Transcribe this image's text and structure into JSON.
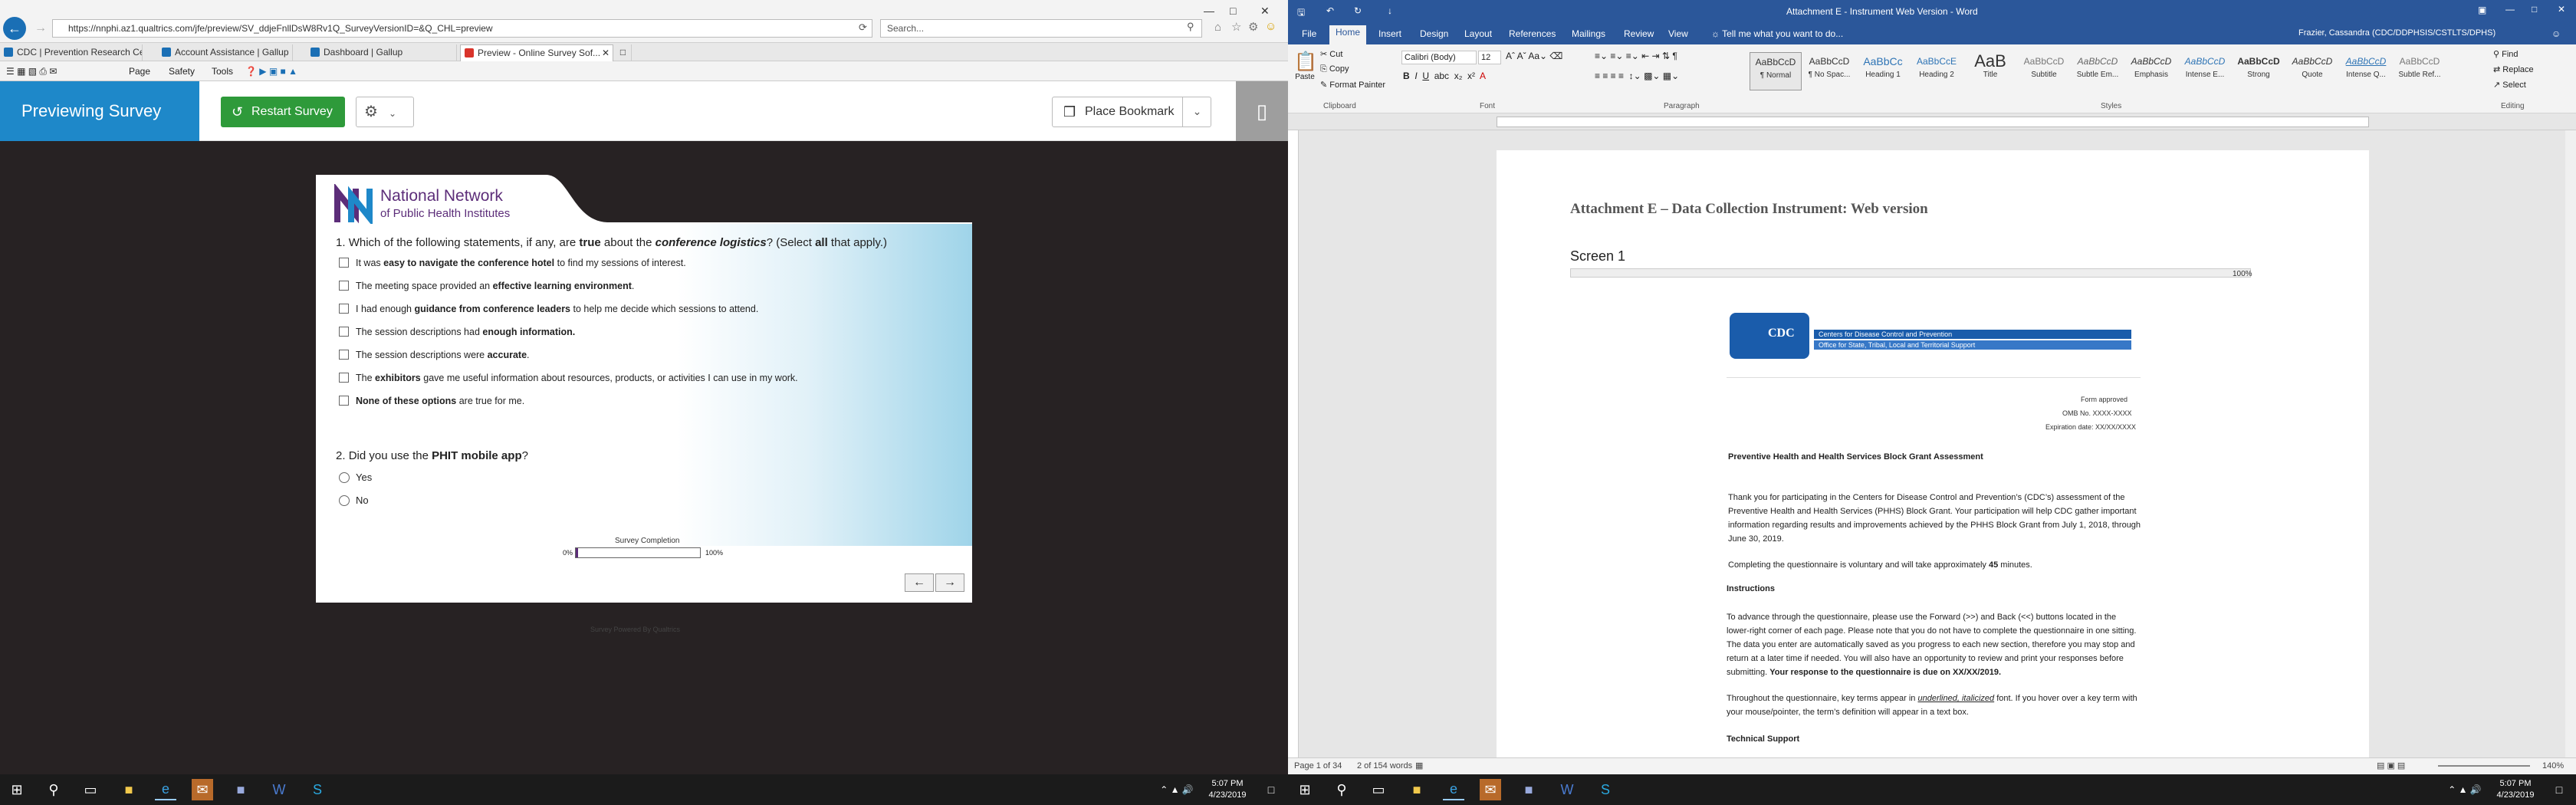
{
  "browser": {
    "url": "https://nnphi.az1.qualtrics.com/jfe/preview/SV_ddjeFnllDsW8Rv1Q_SurveyVersionID=&Q_CHL=preview",
    "search_placeholder": "Search...",
    "tabs": [
      {
        "label": "CDC | Prevention Research Ce...",
        "color": "#1a6fb5"
      },
      {
        "label": "Account Assistance | Gallup",
        "color": "#1a6fb5"
      },
      {
        "label": "Dashboard | Gallup",
        "color": "#1a6fb5"
      },
      {
        "label": "Preview - Online Survey Sof...",
        "color": "#d9342b"
      }
    ],
    "commands": [
      "Page",
      "Safety",
      "Tools"
    ]
  },
  "survey_header": {
    "previewing": "Previewing Survey",
    "restart": "Restart Survey",
    "bookmark": "Place Bookmark"
  },
  "survey": {
    "logo_line1": "National Network",
    "logo_line2": "of Public Health Institutes",
    "q1": {
      "number": "1.",
      "pre": "Which of the following statements, if any, are ",
      "bold1": "true",
      "mid": " about the ",
      "bolditalic": "conference logistics",
      "post1": "? (Select ",
      "bold2": "all",
      "post2": " that apply.)",
      "options": [
        {
          "a": "It was ",
          "b": "easy to navigate the conference hotel",
          "c": " to find my sessions of interest."
        },
        {
          "a": "The meeting space provided an ",
          "b": "effective learning environment",
          "c": "."
        },
        {
          "a": "I had enough ",
          "b": "guidance from conference leaders",
          "c": " to help me decide which sessions to attend."
        },
        {
          "a": "The session descriptions had ",
          "b": "enough information.",
          "c": ""
        },
        {
          "a": "The session descriptions were ",
          "b": "accurate",
          "c": "."
        },
        {
          "a": "The ",
          "b": "exhibitors",
          "c": " gave me useful information about resources, products, or activities I can use in my work."
        },
        {
          "a": "",
          "b": "None of these options",
          "c": " are true for me."
        }
      ]
    },
    "q2": {
      "number": "2.",
      "pre": "Did you use the ",
      "bold": "PHIT mobile app",
      "post": "?",
      "options": [
        "Yes",
        "No"
      ]
    },
    "progress_label": "Survey Completion",
    "progress_min": "0%",
    "progress_max": "100%",
    "progress_value": 0.02,
    "back": "←",
    "next": "→",
    "powered": "Survey Powered By Qualtrics"
  },
  "taskbar_left": {
    "time": "5:07 PM",
    "date": "4/23/2019"
  },
  "word": {
    "title": "Attachment E - Instrument Web Version  -  Word",
    "user": "Frazier, Cassandra (CDC/DDPHSIS/CSTLTS/DPHS)",
    "tabs": [
      "File",
      "Home",
      "Insert",
      "Design",
      "Layout",
      "References",
      "Mailings",
      "Review",
      "View"
    ],
    "tell_me": "Tell me what you want to do...",
    "clipboard": {
      "paste": "Paste",
      "cut": "Cut",
      "copy": "Copy",
      "painter": "Format Painter",
      "label": "Clipboard"
    },
    "font": {
      "name": "Calibri (Body)",
      "size": "12",
      "label": "Font"
    },
    "paragraph_label": "Paragraph",
    "styles_label": "Styles",
    "editing": {
      "find": "Find",
      "replace": "Replace",
      "select": "Select",
      "label": "Editing"
    },
    "styles": [
      {
        "sample": "AaBbCcD",
        "name": "¶ Normal"
      },
      {
        "sample": "AaBbCcD",
        "name": "¶ No Spac..."
      },
      {
        "sample": "AaBbCc",
        "name": "Heading 1"
      },
      {
        "sample": "AaBbCcE",
        "name": "Heading 2"
      },
      {
        "sample": "AaB",
        "name": "Title"
      },
      {
        "sample": "AaBbCcD",
        "name": "Subtitle"
      },
      {
        "sample": "AaBbCcD",
        "name": "Subtle Em..."
      },
      {
        "sample": "AaBbCcD",
        "name": "Emphasis"
      },
      {
        "sample": "AaBbCcD",
        "name": "Intense E..."
      },
      {
        "sample": "AaBbCcD",
        "name": "Strong"
      },
      {
        "sample": "AaBbCcD",
        "name": "Quote"
      },
      {
        "sample": "AaBbCcD",
        "name": "Intense Q..."
      },
      {
        "sample": "AaBbCcD",
        "name": "Subtle Ref..."
      }
    ],
    "doc": {
      "heading": "Attachment E – Data Collection Instrument: Web version",
      "screen": "Screen 1",
      "progress_pct": "100%",
      "cdc_line1": "Centers for Disease Control and Prevention",
      "cdc_line2": "Office for State, Tribal, Local and Territorial Support",
      "cdc": "CDC",
      "form_approved": "Form approved",
      "omb": "OMB No. XXXX-XXXX",
      "expiration": "Expiration date: XX/XX/XXXX",
      "title": "Preventive Health and Health Services Block Grant Assessment",
      "para1": "Thank you for participating in the Centers for Disease Control and Prevention’s (CDC’s) assessment of the Preventive Health and Health Services (PHHS) Block Grant. Your participation will help CDC gather important information regarding results and improvements achieved by the PHHS Block Grant from July 1, 2018, through June 30, 2019.",
      "para2a": "Completing the questionnaire is voluntary and will take approximately ",
      "para2b": "45",
      "para2c": " minutes.",
      "instructions": "Instructions",
      "para3": "To advance through the questionnaire, please use the Forward (>>) and Back (<<) buttons located in the lower-right corner of each page. Please note that you do not have to complete the questionnaire in one sitting. The data you enter are automatically saved as you progress to each new section, therefore you may stop and return at a later time if needed. You will also have an opportunity to review and print your responses before submitting. ",
      "para3b": "Your response to the questionnaire is due on XX/XX/2019.",
      "para4a": "Throughout the questionnaire, key terms appear in ",
      "para4b": "underlined, italicized",
      "para4c": " font. If you hover over a key term with your mouse/pointer, the term’s definition will appear in a text box.",
      "tech": "Technical Support"
    },
    "status_page": "Page 1 of 34",
    "status_words": "2 of 154 words",
    "zoom": "140%"
  },
  "taskbar_right": {
    "time": "5:07 PM",
    "date": "4/23/2019"
  }
}
